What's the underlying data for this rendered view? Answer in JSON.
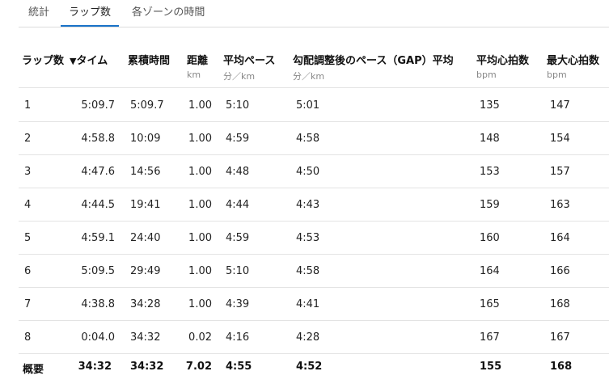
{
  "tabs": [
    {
      "label": "統計"
    },
    {
      "label": "ラップ数"
    },
    {
      "label": "各ゾーンの時間"
    }
  ],
  "columns": {
    "lap": {
      "label": "ラップ数"
    },
    "time": {
      "label": "タイム",
      "sort_indicator": "▼"
    },
    "cumulative": {
      "label": "累積時間"
    },
    "distance": {
      "label": "距離",
      "unit": "km"
    },
    "avg_pace": {
      "label": "平均ペース",
      "unit": "分／km"
    },
    "gap": {
      "label": "勾配調整後のペース（GAP）平均",
      "unit": "分／km"
    },
    "avg_hr": {
      "label": "平均心拍数",
      "unit": "bpm"
    },
    "max_hr": {
      "label": "最大心拍数",
      "unit": "bpm"
    }
  },
  "rows": [
    {
      "lap": "1",
      "time": "5:09.7",
      "cumulative": "5:09.7",
      "distance": "1.00",
      "avg_pace": "5:10",
      "gap": "5:01",
      "avg_hr": "135",
      "max_hr": "147"
    },
    {
      "lap": "2",
      "time": "4:58.8",
      "cumulative": "10:09",
      "distance": "1.00",
      "avg_pace": "4:59",
      "gap": "4:58",
      "avg_hr": "148",
      "max_hr": "154"
    },
    {
      "lap": "3",
      "time": "4:47.6",
      "cumulative": "14:56",
      "distance": "1.00",
      "avg_pace": "4:48",
      "gap": "4:50",
      "avg_hr": "153",
      "max_hr": "157"
    },
    {
      "lap": "4",
      "time": "4:44.5",
      "cumulative": "19:41",
      "distance": "1.00",
      "avg_pace": "4:44",
      "gap": "4:43",
      "avg_hr": "159",
      "max_hr": "163"
    },
    {
      "lap": "5",
      "time": "4:59.1",
      "cumulative": "24:40",
      "distance": "1.00",
      "avg_pace": "4:59",
      "gap": "4:53",
      "avg_hr": "160",
      "max_hr": "164"
    },
    {
      "lap": "6",
      "time": "5:09.5",
      "cumulative": "29:49",
      "distance": "1.00",
      "avg_pace": "5:10",
      "gap": "4:58",
      "avg_hr": "164",
      "max_hr": "166"
    },
    {
      "lap": "7",
      "time": "4:38.8",
      "cumulative": "34:28",
      "distance": "1.00",
      "avg_pace": "4:39",
      "gap": "4:41",
      "avg_hr": "165",
      "max_hr": "168"
    },
    {
      "lap": "8",
      "time": "0:04.0",
      "cumulative": "34:32",
      "distance": "0.02",
      "avg_pace": "4:16",
      "gap": "4:28",
      "avg_hr": "167",
      "max_hr": "167"
    }
  ],
  "summary": {
    "lap": "概要",
    "time": "34:32",
    "cumulative": "34:32",
    "distance": "7.02",
    "avg_pace": "4:55",
    "gap": "4:52",
    "avg_hr": "155",
    "max_hr": "168"
  }
}
